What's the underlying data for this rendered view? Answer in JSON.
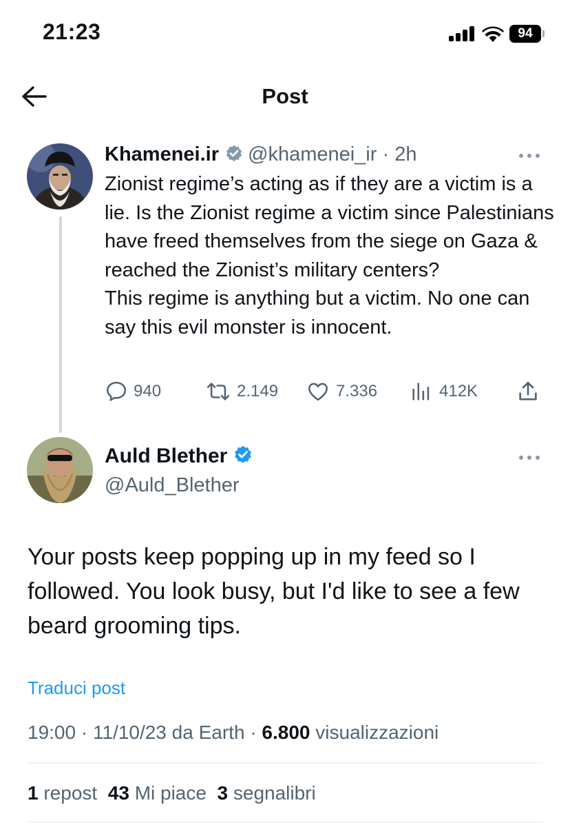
{
  "status_bar": {
    "time": "21:23",
    "battery": "94"
  },
  "nav": {
    "title": "Post"
  },
  "quoted_post": {
    "author_name": "Khamenei.ir",
    "handle": "@khamenei_ir",
    "separator": "·",
    "age": "2h",
    "text": "Zionist regime’s acting as if they are a victim is a lie. Is the Zionist regime a victim since Palestinians have freed themselves from the siege on Gaza & reached the Zionist’s military centers?\nThis regime is anything but a victim. No one can say this evil monster is innocent.",
    "actions": {
      "replies": "940",
      "reposts": "2.149",
      "likes": "7.336",
      "views": "412K"
    }
  },
  "main_post": {
    "author_name": "Auld Blether",
    "handle": "@Auld_Blether",
    "text": "Your posts keep popping up in my feed so I followed.  You look busy, but I'd like to see a few beard grooming tips.",
    "translate_label": "Traduci post",
    "time": "19:00",
    "date": "11/10/23",
    "source": "da Earth",
    "views_count": "6.800",
    "views_label": "visualizzazioni",
    "sep": "·"
  },
  "stats": {
    "reposts_count": "1",
    "reposts_label": "repost",
    "likes_count": "43",
    "likes_label": "Mi piace",
    "bookmarks_count": "3",
    "bookmarks_label": "segnalibri"
  },
  "colors": {
    "accent": "#1d9bf0",
    "text": "#0f1419",
    "muted": "#536471",
    "verified_gray": "#829aab",
    "verified_blue": "#1d9bf0"
  }
}
